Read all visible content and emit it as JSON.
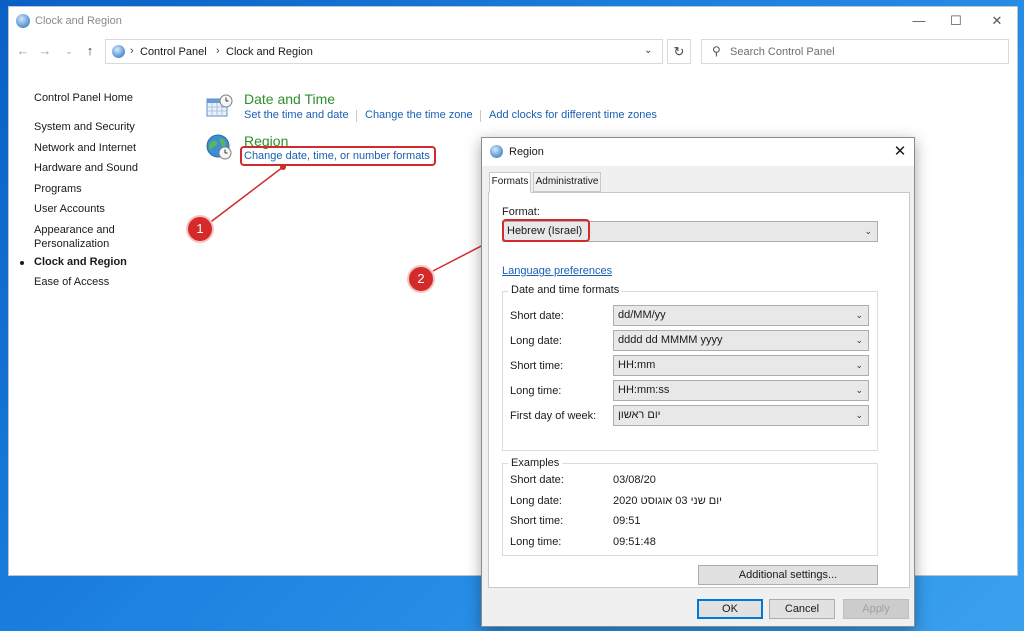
{
  "window": {
    "title": "Clock and Region",
    "controls": {
      "minimize": "—",
      "maximize": "☐",
      "close": "✕"
    }
  },
  "address": {
    "crumbs": [
      "Control Panel",
      "Clock and Region"
    ],
    "separator": "›",
    "search_placeholder": "Search Control Panel"
  },
  "sidebar": {
    "items": [
      {
        "label": "Control Panel Home"
      },
      {
        "label": "System and Security"
      },
      {
        "label": "Network and Internet"
      },
      {
        "label": "Hardware and Sound"
      },
      {
        "label": "Programs"
      },
      {
        "label": "User Accounts"
      },
      {
        "label": "Appearance and",
        "label2": "Personalization"
      },
      {
        "label": "Clock and Region",
        "current": true
      },
      {
        "label": "Ease of Access"
      }
    ]
  },
  "categories": {
    "date_time": {
      "title": "Date and Time",
      "links": [
        "Set the time and date",
        "Change the time zone",
        "Add clocks for different time zones"
      ]
    },
    "region": {
      "title": "Region",
      "links": [
        "Change date, time, or number formats"
      ]
    }
  },
  "annotations": {
    "badge1": "1",
    "badge2": "2",
    "color": "#d22b2b"
  },
  "dialog": {
    "title": "Region",
    "tabs": [
      "Formats",
      "Administrative"
    ],
    "format_label": "Format:",
    "format_value": "Hebrew (Israel)",
    "language_link": "Language preferences",
    "datetime_group": "Date and time formats",
    "fields": [
      {
        "label": "Short date:",
        "value": "dd/MM/yy"
      },
      {
        "label": "Long date:",
        "value": "dddd dd MMMM yyyy"
      },
      {
        "label": "Short time:",
        "value": "HH:mm"
      },
      {
        "label": "Long time:",
        "value": "HH:mm:ss"
      },
      {
        "label": "First day of week:",
        "value": "יום ראשון"
      }
    ],
    "examples_group": "Examples",
    "examples": [
      {
        "label": "Short date:",
        "value": "03/08/20"
      },
      {
        "label": "Long date:",
        "value": "יום שני 03 אוגוסט 2020"
      },
      {
        "label": "Short time:",
        "value": "09:51"
      },
      {
        "label": "Long time:",
        "value": "09:51:48"
      }
    ],
    "additional_settings": "Additional settings...",
    "ok": "OK",
    "cancel": "Cancel",
    "apply": "Apply"
  }
}
